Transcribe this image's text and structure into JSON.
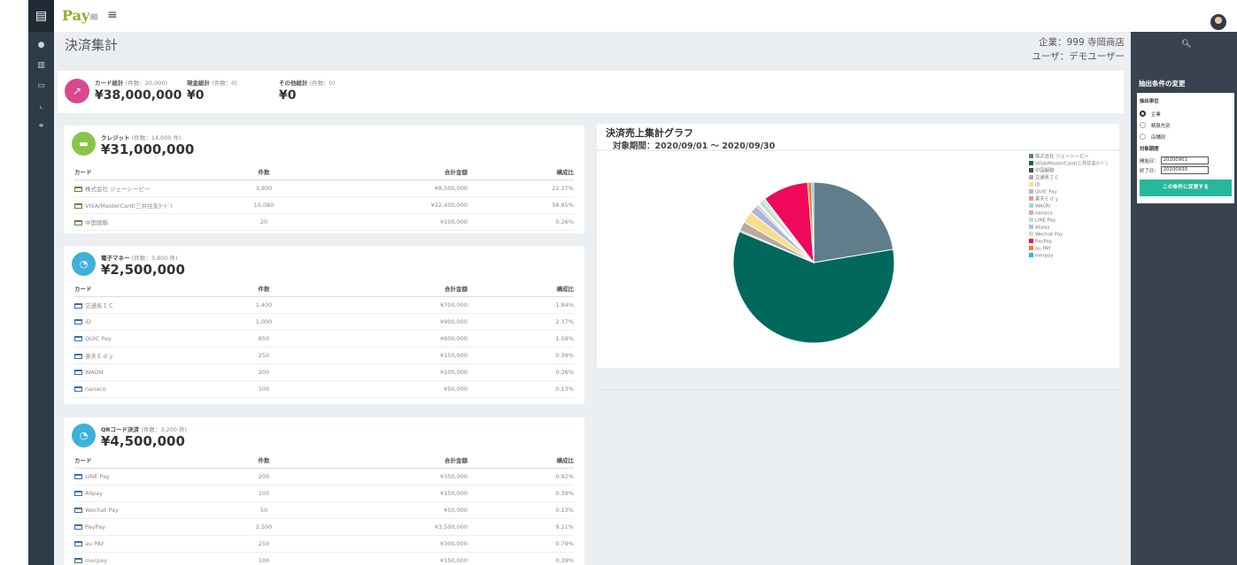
{
  "app": {
    "logo": "Pay",
    "logo_mark": "leaf-wing-logo"
  },
  "left_nav": [
    "card-icon",
    "home-icon",
    "bank-icon",
    "list-icon",
    "chart-icon",
    "users-icon"
  ],
  "page": {
    "title": "決済集計",
    "company": "企業：999 寺岡商店",
    "user": "ユーザ：デモユーザー"
  },
  "summary": {
    "items": [
      {
        "label": "カード総計",
        "count": "(件数：20,000)",
        "value": "¥38,000,000"
      },
      {
        "label": "現金総計",
        "count": "(件数：0)",
        "value": "¥0"
      },
      {
        "label": "その他総計",
        "count": "(件数：0)",
        "value": "¥0"
      }
    ]
  },
  "headers": {
    "card": "カード",
    "count": "件数",
    "total": "合計金額",
    "ratio": "構成比"
  },
  "credit": {
    "label": "クレジット",
    "count": "(件数：14,000 件)",
    "value": "¥31,000,000",
    "rows": [
      {
        "name": "株式会社 ジェーシービー",
        "count": "3,900",
        "total": "¥8,500,000",
        "ratio": "22.37%"
      },
      {
        "name": "VISA/MasterCard(三井住友ｶｰﾄﾞ)",
        "count": "10,080",
        "total": "¥22,400,000",
        "ratio": "58.95%"
      },
      {
        "name": "中国銀聯",
        "count": "20",
        "total": "¥100,000",
        "ratio": "0.26%"
      }
    ]
  },
  "emoney": {
    "label": "電子マネー",
    "count": "(件数：3,800 件)",
    "value": "¥2,500,000",
    "rows": [
      {
        "name": "交通系ＩＣ",
        "count": "1,400",
        "total": "¥700,000",
        "ratio": "1.84%"
      },
      {
        "name": "iD",
        "count": "1,000",
        "total": "¥900,000",
        "ratio": "2.37%"
      },
      {
        "name": "QUIC Pay",
        "count": "850",
        "total": "¥600,000",
        "ratio": "1.58%"
      },
      {
        "name": "楽天Ｅｄｙ",
        "count": "250",
        "total": "¥150,000",
        "ratio": "0.39%"
      },
      {
        "name": "WAON",
        "count": "200",
        "total": "¥100,000",
        "ratio": "0.26%"
      },
      {
        "name": "nanaco",
        "count": "100",
        "total": "¥50,000",
        "ratio": "0.13%"
      }
    ]
  },
  "qr": {
    "label": "QRコード決済",
    "count": "(件数：3,200 件)",
    "value": "¥4,500,000",
    "rows": [
      {
        "name": "LINE Pay",
        "count": "200",
        "total": "¥350,000",
        "ratio": "0.92%"
      },
      {
        "name": "Alipay",
        "count": "100",
        "total": "¥150,000",
        "ratio": "0.39%"
      },
      {
        "name": "Wechat Pay",
        "count": "50",
        "total": "¥50,000",
        "ratio": "0.13%"
      },
      {
        "name": "PayPay",
        "count": "2,500",
        "total": "¥3,500,000",
        "ratio": "9.21%"
      },
      {
        "name": "au PAY",
        "count": "250",
        "total": "¥300,000",
        "ratio": "0.79%"
      },
      {
        "name": "merpay",
        "count": "100",
        "total": "¥150,000",
        "ratio": "0.39%"
      }
    ]
  },
  "graph": {
    "title": "決済売上集計グラフ",
    "period": "対象期間：2020/09/01 ～ 2020/09/30"
  },
  "chart_data": {
    "type": "pie",
    "title": "決済売上集計グラフ",
    "labels": [
      "株式会社 ジェーシービー",
      "VISA/MasterCard(三井住友ｶｰﾄﾞ)",
      "中国銀聯",
      "交通系ＩＣ",
      "iD",
      "QUIC Pay",
      "楽天Ｅｄｙ",
      "WAON",
      "nanaco",
      "LINE Pay",
      "Alipay",
      "Wechat Pay",
      "PayPay",
      "au PAY",
      "merpay"
    ],
    "values": [
      8500000,
      22400000,
      100000,
      700000,
      900000,
      600000,
      150000,
      100000,
      50000,
      350000,
      150000,
      50000,
      3500000,
      300000,
      150000
    ],
    "colors": [
      "#607d8b",
      "#00695c",
      "#4a4a4a",
      "#b9a9a0",
      "#f6de8c",
      "#aab5dd",
      "#d99a9a",
      "#9fd6e6",
      "#e9a0bb",
      "#bfe3b8",
      "#9fc8e6",
      "#c7e8c0",
      "#f0085a",
      "#ff7a1a",
      "#29b6f6"
    ],
    "legend_position": "right"
  },
  "right_panel": {
    "title": "抽出条件の変更",
    "unit_label": "抽出単位",
    "units": [
      "企業",
      "精算先別",
      "店舗別"
    ],
    "selected_unit": "企業",
    "period_label": "対象期間",
    "start_label": "開始日：",
    "start": "20200901",
    "end_label": "終了日：",
    "end": "20200930",
    "apply": "この条件に変更する"
  }
}
